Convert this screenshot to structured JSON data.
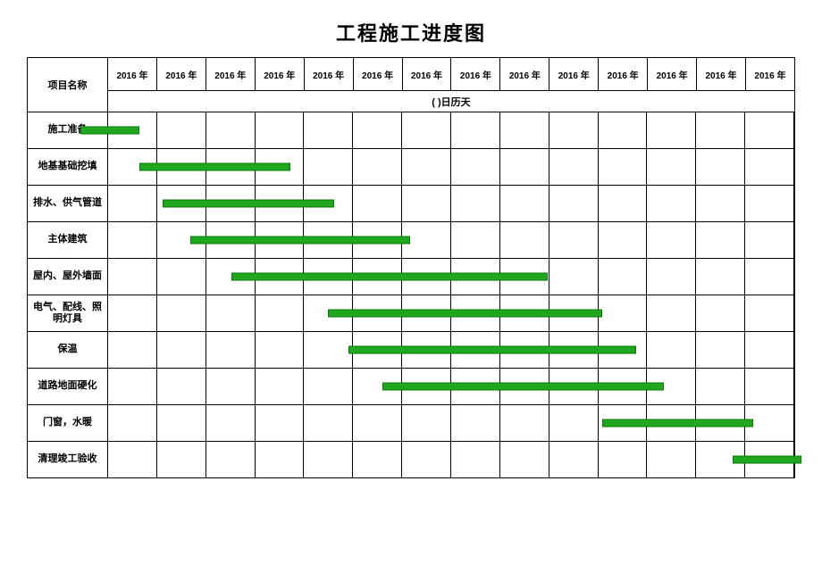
{
  "title": "工程施工进度图",
  "row_header_label": "项目名称",
  "sub_header": "(      )日历天",
  "year_headers": [
    "2016 年",
    "2016 年",
    "2016 年",
    "2016 年",
    "2016 年",
    "2016 年",
    "2016 年",
    "2016 年",
    "2016 年",
    "2016 年",
    "2016 年",
    "2016 年",
    "2016 年",
    "2016 年"
  ],
  "tasks": [
    {
      "name": "施工准备"
    },
    {
      "name": "地基基础挖填"
    },
    {
      "name": "排水、供气管道"
    },
    {
      "name": "主体建筑"
    },
    {
      "name": "屋内、屋外墙面"
    },
    {
      "name": "电气、配线、照明灯具"
    },
    {
      "name": "保温"
    },
    {
      "name": "道路地面硬化"
    },
    {
      "name": "门窗，水暖"
    },
    {
      "name": "清理竣工验收"
    }
  ],
  "chart_data": {
    "type": "gantt",
    "title": "工程施工进度图",
    "xlabel": "日历天",
    "x_unit_count": 14,
    "year": "2016",
    "categories": [
      "施工准备",
      "地基基础挖填",
      "排水、供气管道",
      "主体建筑",
      "屋内、屋外墙面",
      "电气、配线、照明灯具",
      "保温",
      "道路地面硬化",
      "门窗，水暖",
      "清理竣工验收"
    ],
    "bars": [
      {
        "task": "施工准备",
        "start_pct": -4,
        "width_pct": 8.5
      },
      {
        "task": "地基基础挖填",
        "start_pct": 4.5,
        "width_pct": 22
      },
      {
        "task": "排水、供气管道",
        "start_pct": 8,
        "width_pct": 25
      },
      {
        "task": "主体建筑",
        "start_pct": 12,
        "width_pct": 32
      },
      {
        "task": "屋内、屋外墙面",
        "start_pct": 18,
        "width_pct": 46
      },
      {
        "task": "电气、配线、照明灯具",
        "start_pct": 32,
        "width_pct": 40
      },
      {
        "task": "保温",
        "start_pct": 35,
        "width_pct": 42
      },
      {
        "task": "道路地面硬化",
        "start_pct": 40,
        "width_pct": 41
      },
      {
        "task": "门窗，水暖",
        "start_pct": 72,
        "width_pct": 22
      },
      {
        "task": "清理竣工验收",
        "start_pct": 91,
        "width_pct": 10
      }
    ]
  }
}
